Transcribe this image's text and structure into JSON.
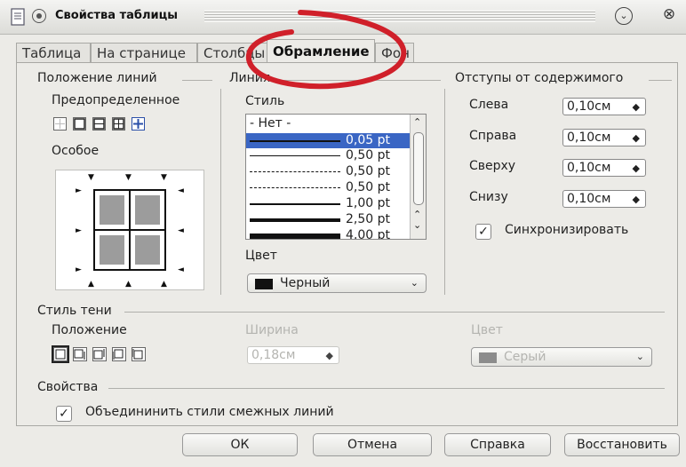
{
  "window": {
    "title": "Свойства таблицы"
  },
  "tabs": [
    {
      "label": "Таблица",
      "active": false
    },
    {
      "label": "На странице",
      "active": false
    },
    {
      "label": "Столбцы",
      "active": false
    },
    {
      "label": "Обрамление",
      "active": true
    },
    {
      "label": "Фон",
      "active": false
    }
  ],
  "line_arrangement": {
    "title": "Положение линий",
    "preset_label": "Предопределенное",
    "custom_label": "Особое"
  },
  "line": {
    "title": "Линия",
    "style_label": "Стиль",
    "styles": [
      "- Нет -",
      "0,05 pt",
      "0,50 pt",
      "0,50 pt",
      "0,50 pt",
      "1,00 pt",
      "2,50 pt",
      "4,00 pt"
    ],
    "selected_style": "0,05 pt",
    "color_label": "Цвет",
    "color_value": "Черный"
  },
  "spacing": {
    "title": "Отступы от содержимого",
    "left_label": "Слева",
    "left_value": "0,10см",
    "right_label": "Справа",
    "right_value": "0,10см",
    "top_label": "Сверху",
    "top_value": "0,10см",
    "bottom_label": "Снизу",
    "bottom_value": "0,10см",
    "sync_label": "Синхронизировать",
    "sync_checked": true
  },
  "shadow": {
    "title": "Стиль тени",
    "position_label": "Положение",
    "width_label": "Ширина",
    "width_value": "0,18см",
    "color_label": "Цвет",
    "color_value": "Серый"
  },
  "properties": {
    "title": "Свойства",
    "merge_label": "Объедининить стили смежных линий",
    "merge_checked": true
  },
  "buttons": {
    "ok": "ОК",
    "cancel": "Отмена",
    "help": "Справка",
    "reset": "Восстановить"
  },
  "colors": {
    "selection": "#3a66c4",
    "annotation_ring": "#d0202a"
  }
}
